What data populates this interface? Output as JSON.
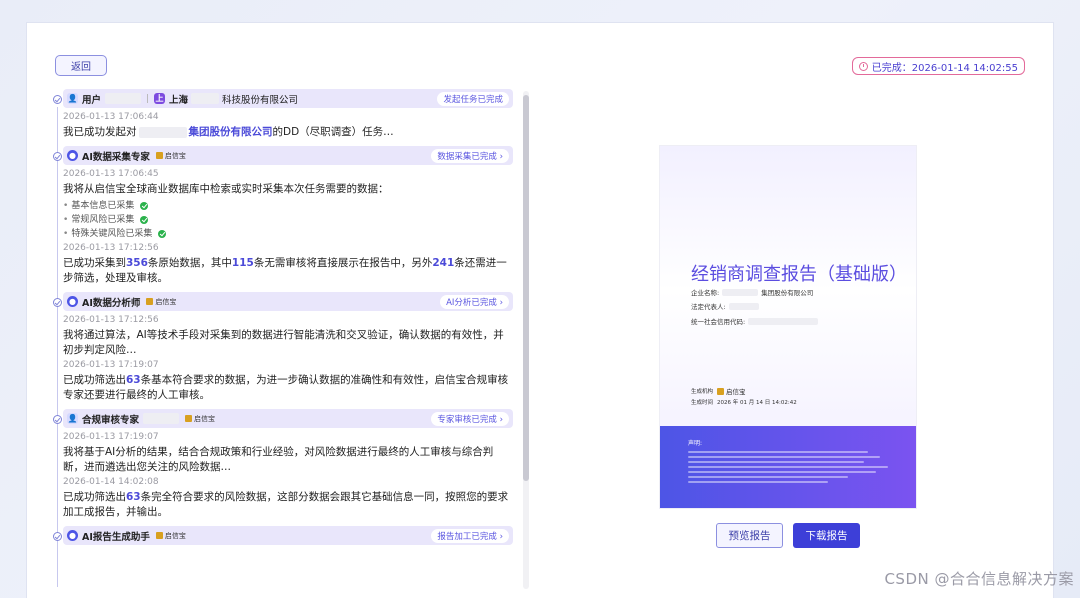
{
  "header": {
    "back_label": "返回",
    "done_label": "已完成：2026-01-14 14:02:55"
  },
  "timeline": {
    "entry1": {
      "role": "用户",
      "location": "上海",
      "company": "科技股份有限公司",
      "status": "发起任务已完成",
      "ts": "2026-01-13 17:06:44",
      "msg_a": "我已成功发起对",
      "msg_company": "集团股份有限公司",
      "msg_b": "的DD（尽职调查）任务…"
    },
    "entry2": {
      "role": "AI数据采集专家",
      "brand": "启信宝",
      "status": "数据采集已完成 ›",
      "ts1": "2026-01-13 17:06:45",
      "msg1": "我将从启信宝全球商业数据库中检索或实时采集本次任务需要的数据：",
      "bullets": [
        "基本信息已采集",
        "常规风险已采集",
        "特殊关键风险已采集"
      ],
      "ts2": "2026-01-13 17:12:56",
      "msg2_a": "已成功采集到",
      "n1": "356",
      "msg2_b": "条原始数据，其中",
      "n2": "115",
      "msg2_c": "条无需审核将直接展示在报告中，另外",
      "n3": "241",
      "msg2_d": "条还需进一步筛选，处理及审核。"
    },
    "entry3": {
      "role": "AI数据分析师",
      "brand": "启信宝",
      "status": "AI分析已完成 ›",
      "ts1": "2026-01-13 17:12:56",
      "msg1": "我将通过算法，AI等技术手段对采集到的数据进行智能清洗和交叉验证，确认数据的有效性，并初步判定风险…",
      "ts2": "2026-01-13 17:19:07",
      "msg2_a": "已成功筛选出",
      "n1": "63",
      "msg2_b": "条基本符合要求的数据，为进一步确认数据的准确性和有效性，启信宝合规审核专家还要进行最终的人工审核。"
    },
    "entry4": {
      "role": "合规审核专家",
      "brand": "启信宝",
      "status": "专家审核已完成 ›",
      "ts1": "2026-01-13 17:19:07",
      "msg1": "我将基于AI分析的结果，结合合规政策和行业经验，对风险数据进行最终的人工审核与综合判断，进而遴选出您关注的风险数据…",
      "ts2": "2026-01-14 14:02:08",
      "msg2_a": "已成功筛选出",
      "n1": "63",
      "msg2_b": "条完全符合要求的风险数据，这部分数据会跟其它基础信息一同，按照您的要求加工成报告，并输出。"
    },
    "entry5": {
      "role": "AI报告生成助手",
      "brand": "启信宝",
      "status": "报告加工已完成 ›"
    }
  },
  "report": {
    "title": "经销商调查报告（基础版）",
    "company_label": "企业名称:",
    "company_value": "集团股份有限公司",
    "legal_label": "法定代表人:",
    "credit_label": "统一社会信用代码:",
    "gen_org_label": "生成机构",
    "gen_org_value": "启信宝",
    "gen_time_label": "生成时间",
    "gen_time_value": "2026 年 01 月 14 日  14:02:42",
    "disclaimer_title": "声明:"
  },
  "actions": {
    "preview": "预览报告",
    "download": "下载报告"
  },
  "watermark": "CSDN @合合信息解决方案"
}
